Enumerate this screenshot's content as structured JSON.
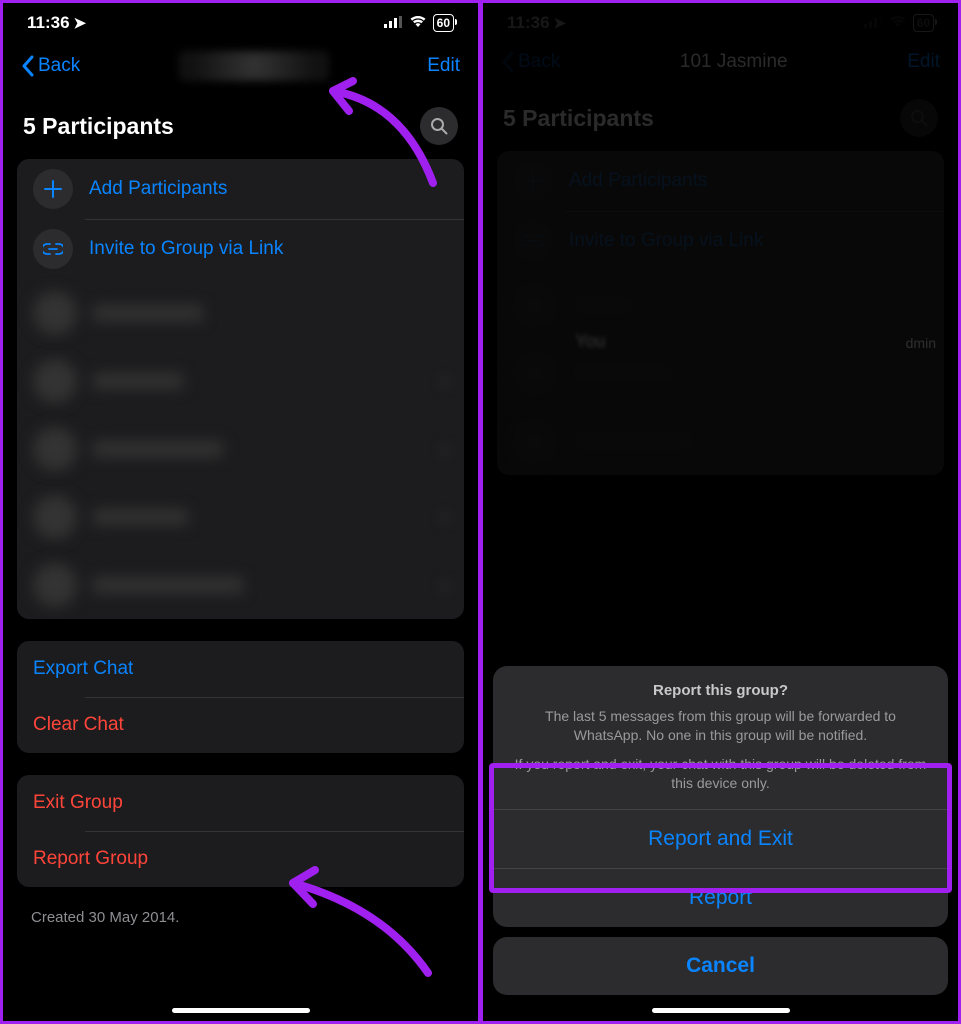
{
  "status": {
    "time": "11:36",
    "battery": "60"
  },
  "nav": {
    "back": "Back",
    "edit": "Edit",
    "title2": "101 Jasmine"
  },
  "participants": {
    "title": "5 Participants",
    "add": "Add Participants",
    "invite": "Invite to Group via Link"
  },
  "actions": {
    "export": "Export Chat",
    "clear": "Clear Chat",
    "exit": "Exit Group",
    "report": "Report Group"
  },
  "created": "Created 30 May 2014.",
  "right": {
    "you": "You",
    "admin": "dmin"
  },
  "sheet": {
    "title": "Report this group?",
    "msg1": "The last 5 messages from this group will be forwarded to WhatsApp. No one in this group will be notified.",
    "msg2": "If you report and exit, your chat with this group will be deleted from this device only.",
    "reportExit": "Report and Exit",
    "reportOnly": "Report",
    "cancel": "Cancel"
  }
}
